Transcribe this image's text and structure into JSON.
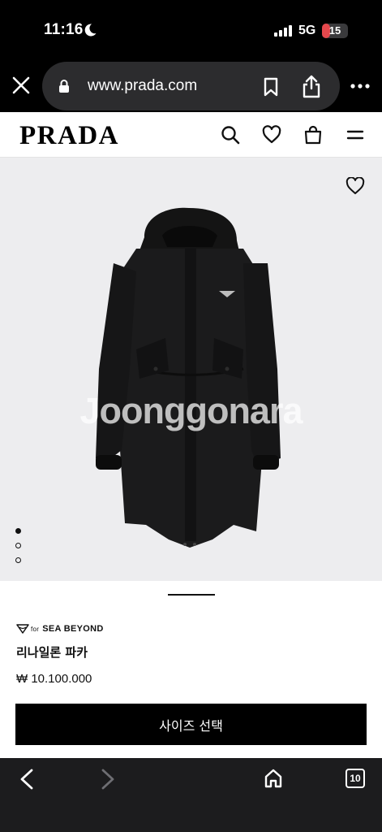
{
  "status_bar": {
    "time": "11:16",
    "network": "5G",
    "battery_level": "15",
    "battery_fraction": 0.15,
    "battery_color": "#e5484d"
  },
  "browser": {
    "url": "www.prada.com",
    "icons": [
      "close-icon",
      "lock-icon",
      "bookmark-icon",
      "share-icon",
      "more-icon"
    ]
  },
  "site_header": {
    "logo": "PRADA",
    "icons": [
      "search-icon",
      "heart-icon",
      "shopping-bag-icon",
      "menu-icon"
    ]
  },
  "product": {
    "image_watermark": "Joonggonara",
    "image_dots": 3,
    "active_dot": 0,
    "brand_prefix": "for",
    "brand_line": "SEA BEYOND",
    "name": "리나일론 파카",
    "price": "₩ 10.100.000",
    "size_button": "사이즈 선택"
  },
  "toolbar": {
    "tabs_count": "10",
    "icons": [
      "back-icon",
      "forward-icon",
      "home-icon",
      "tabs-icon"
    ]
  }
}
